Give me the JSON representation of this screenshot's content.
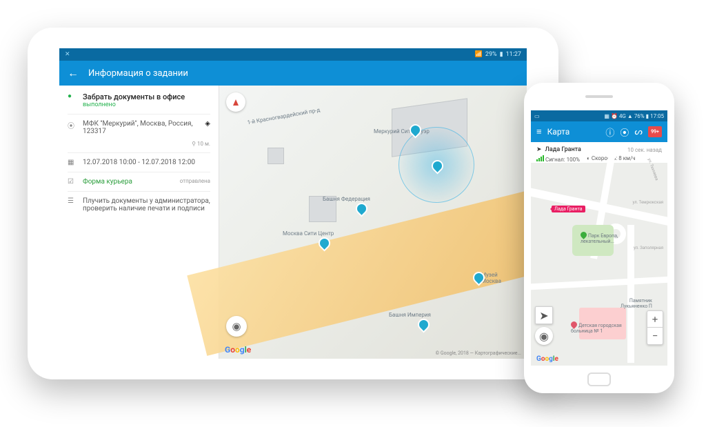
{
  "tablet": {
    "status": {
      "battery": "29%",
      "time": "11:27"
    },
    "appbar_title": "Информация о задании",
    "task": {
      "title": "Забрать документы в офисе",
      "status": "выполнено",
      "address": "МФК \"Меркурий\", Москва, Россия, 123317",
      "distance": "10 м.",
      "time_window": "12.07.2018 10:00 - 12.07.2018 12:00",
      "form_label": "Форма курьера",
      "form_status": "отправлена",
      "note": "Плучить документы у администратора, проверить наличие печати и подписи"
    },
    "map": {
      "pois": {
        "mercury": "Меркурий Сити Тауэр",
        "federation": "Башня Федерация",
        "citycenter": "Москва Сити Центр",
        "imperia": "Башня Империя",
        "museum": "Музей\nМосква",
        "road": "1-й Красногвардейский пр-д"
      },
      "copyright": "© Google, 2018 — Картографические..."
    }
  },
  "phone": {
    "status": {
      "battery": "76%",
      "time": "17:05"
    },
    "appbar_title": "Карта",
    "badge": "99+",
    "vehicle": {
      "name": "Лада Гранта",
      "ago": "10 сек. назад",
      "signal_label": "Сигнал: 100%",
      "speed_label": "Скорость: 8 км/ч"
    },
    "map": {
      "vehicle_tag": "Лада Гранта",
      "pois": {
        "park": "Парк Европа,\nлекательный...",
        "monument": "Памятник\nЛукьяненко П",
        "hospital": "Детская городская\nбольница № 1"
      },
      "streets": {
        "s1": "ул. Тюляева",
        "s2": "ул. Темрюкская",
        "s3": "ул. Заполярная"
      }
    }
  }
}
